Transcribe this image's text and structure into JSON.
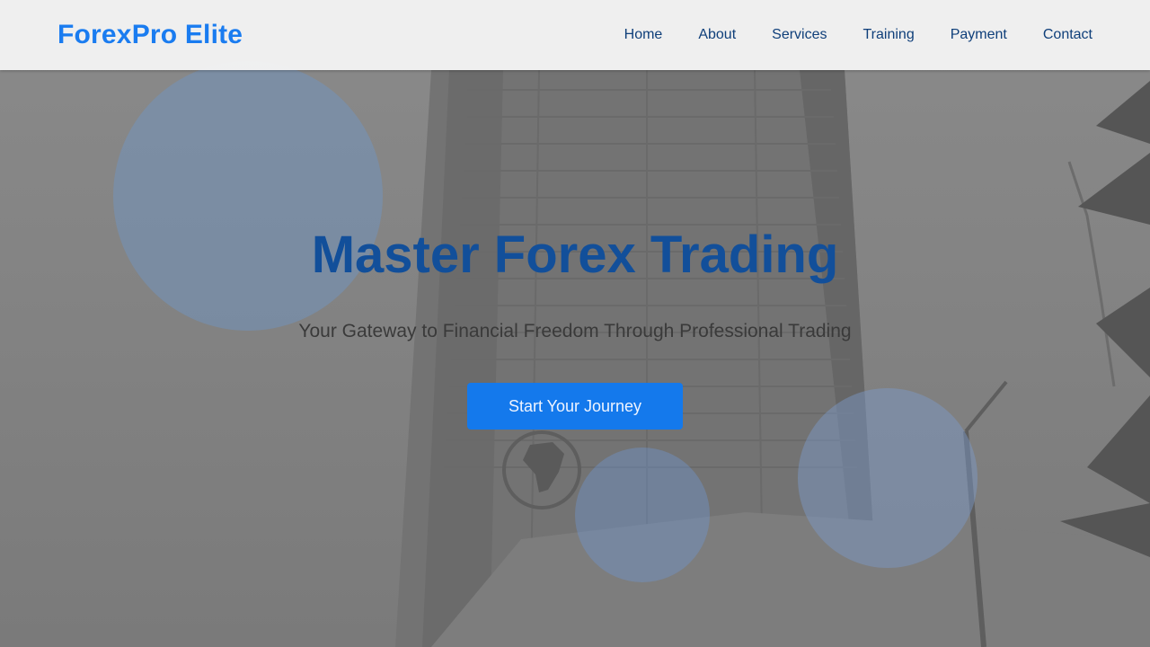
{
  "brand": {
    "name": "ForexPro Elite"
  },
  "nav": {
    "items": [
      {
        "label": "Home"
      },
      {
        "label": "About"
      },
      {
        "label": "Services"
      },
      {
        "label": "Training"
      },
      {
        "label": "Payment"
      },
      {
        "label": "Contact"
      }
    ]
  },
  "hero": {
    "title": "Master Forex Trading",
    "subtitle": "Your Gateway to Financial Freedom Through Professional Trading",
    "cta_label": "Start Your Journey"
  },
  "colors": {
    "brand_blue": "#1a7cf0",
    "nav_text": "#0f3f7a",
    "title_blue": "#124f9a",
    "cta_bg": "#1479ec"
  },
  "icons": [
    "africa-emblem-icon"
  ]
}
